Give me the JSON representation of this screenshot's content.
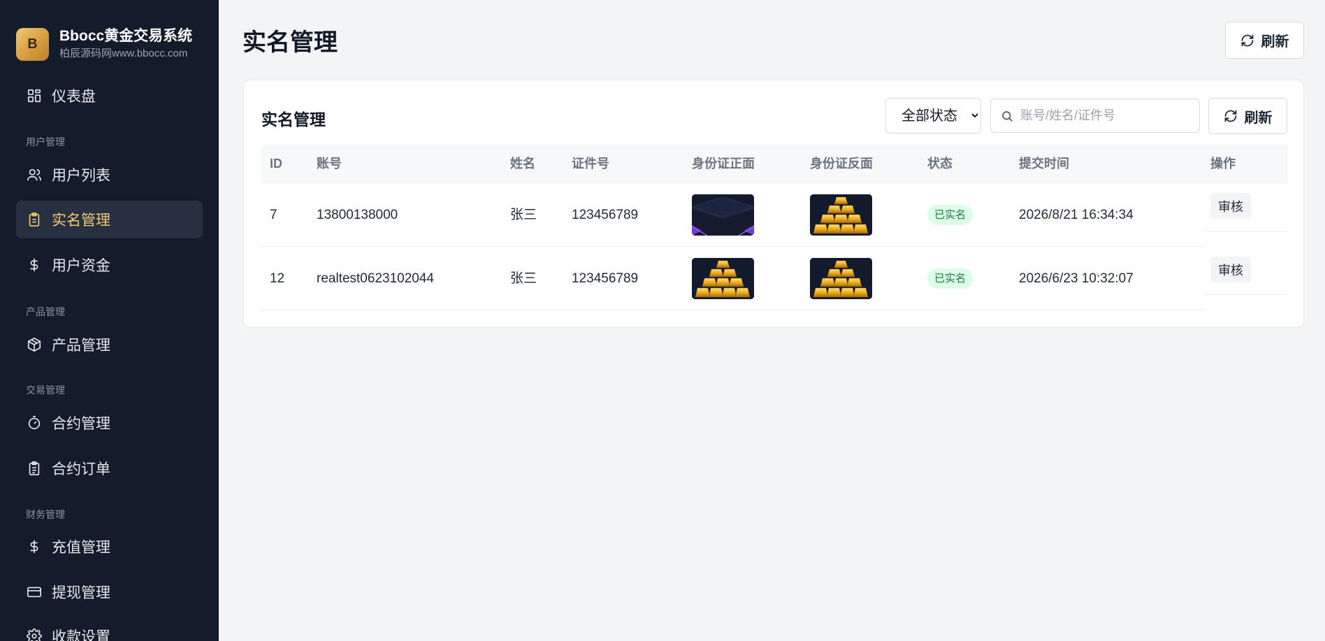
{
  "brand": {
    "logo_letter": "B",
    "title": "Bbocc黄金交易系统",
    "subtitle": "柏辰源码网www.bbocc.com"
  },
  "sidebar": {
    "items": [
      {
        "label": "仪表盘",
        "icon": "grid-icon"
      },
      {
        "group": "用户管理"
      },
      {
        "label": "用户列表",
        "icon": "users-icon"
      },
      {
        "label": "实名管理",
        "icon": "clipboard-icon",
        "active": true
      },
      {
        "label": "用户资金",
        "icon": "dollar-icon"
      },
      {
        "group": "产品管理"
      },
      {
        "label": "产品管理",
        "icon": "box-icon"
      },
      {
        "group": "交易管理"
      },
      {
        "label": "合约管理",
        "icon": "timer-icon"
      },
      {
        "label": "合约订单",
        "icon": "clipboard-list-icon"
      },
      {
        "group": "财务管理"
      },
      {
        "label": "充值管理",
        "icon": "dollar-icon"
      },
      {
        "label": "提现管理",
        "icon": "card-icon"
      },
      {
        "label": "收款设置",
        "icon": "gear-icon"
      }
    ]
  },
  "header": {
    "title": "实名管理",
    "refresh_label": "刷新"
  },
  "card": {
    "title": "实名管理",
    "status_select": {
      "selected": "全部状态"
    },
    "search": {
      "placeholder": "账号/姓名/证件号"
    },
    "refresh_label": "刷新"
  },
  "table": {
    "columns": [
      "ID",
      "账号",
      "姓名",
      "证件号",
      "身份证正面",
      "身份证反面",
      "状态",
      "提交时间",
      "操作"
    ],
    "rows": [
      {
        "id": "7",
        "account": "13800138000",
        "name": "张三",
        "id_number": "123456789",
        "front": "dark-card-image",
        "back": "gold-bars-image",
        "status": "已实名",
        "time": "2026/8/21 16:34:34",
        "action": "审核"
      },
      {
        "id": "12",
        "account": "realtest0623102044",
        "name": "张三",
        "id_number": "123456789",
        "front": "gold-bars-image",
        "back": "gold-bars-image",
        "status": "已实名",
        "time": "2026/6/23 10:32:07",
        "action": "审核"
      }
    ]
  },
  "colors": {
    "sidebar_bg": "#141b2b",
    "accent_gold": "#f3c873",
    "badge_green_bg": "#dcfce7",
    "badge_green_text": "#15803d"
  }
}
